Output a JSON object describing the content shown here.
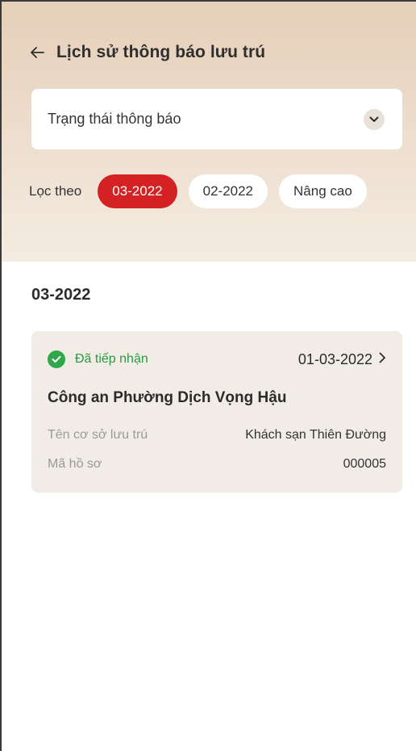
{
  "header": {
    "title": "Lịch sử thông báo lưu trú",
    "back_icon": "arrow-left-icon"
  },
  "status_select": {
    "label": "Trạng thái thông báo",
    "icon": "chevron-down-icon"
  },
  "filter": {
    "label": "Lọc theo",
    "chips": [
      {
        "label": "03-2022",
        "active": true
      },
      {
        "label": "02-2022",
        "active": false
      },
      {
        "label": "Nâng cao",
        "active": false
      }
    ]
  },
  "section": {
    "title": "03-2022",
    "items": [
      {
        "status": "Đã tiếp nhận",
        "status_icon": "check-circle-icon",
        "date": "01-03-2022",
        "station": "Công an Phường Dịch Vọng Hậu",
        "fields": [
          {
            "key": "Tên cơ sở lưu trú",
            "value": "Khách sạn Thiên Đường"
          },
          {
            "key": "Mã hồ sơ",
            "value": "000005"
          }
        ]
      }
    ]
  },
  "colors": {
    "accent_red": "#d42123",
    "status_green": "#2fa84a",
    "card_bg": "#f1ece6"
  }
}
